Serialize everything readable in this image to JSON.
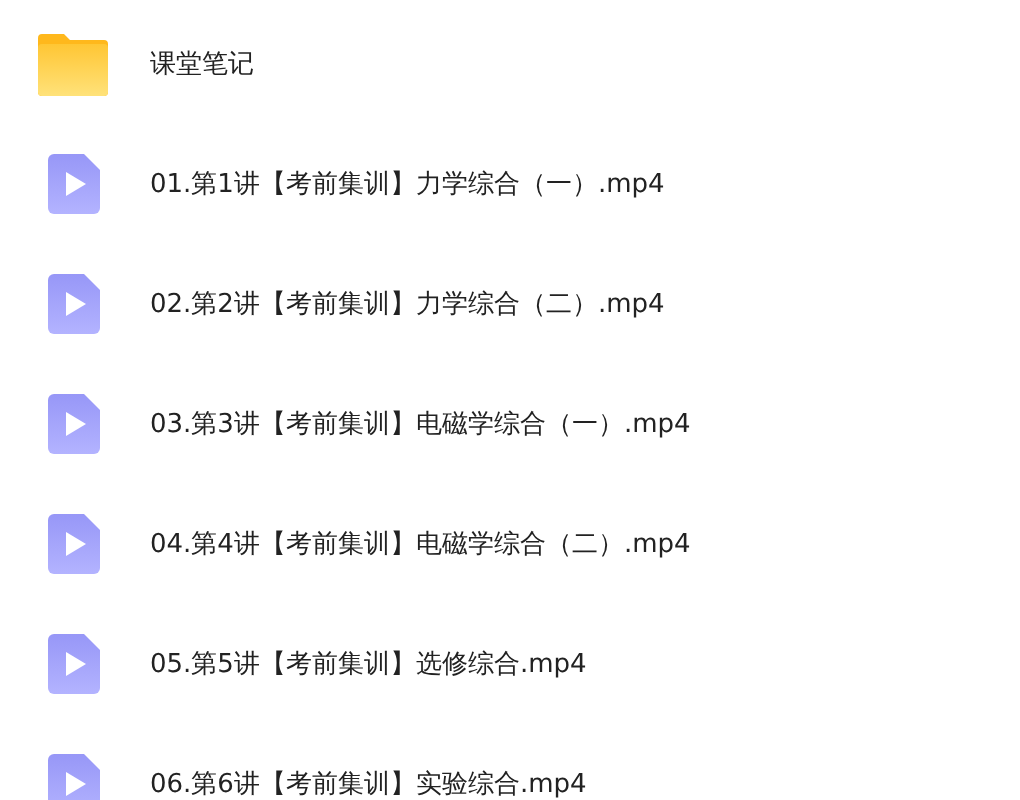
{
  "files": [
    {
      "kind": "folder",
      "name": "课堂笔记"
    },
    {
      "kind": "video",
      "name": "01.第1讲【考前集训】力学综合（一）.mp4"
    },
    {
      "kind": "video",
      "name": "02.第2讲【考前集训】力学综合（二）.mp4"
    },
    {
      "kind": "video",
      "name": "03.第3讲【考前集训】电磁学综合（一）.mp4"
    },
    {
      "kind": "video",
      "name": "04.第4讲【考前集训】电磁学综合（二）.mp4"
    },
    {
      "kind": "video",
      "name": "05.第5讲【考前集训】选修综合.mp4"
    },
    {
      "kind": "video",
      "name": "06.第6讲【考前集训】实验综合.mp4"
    }
  ]
}
